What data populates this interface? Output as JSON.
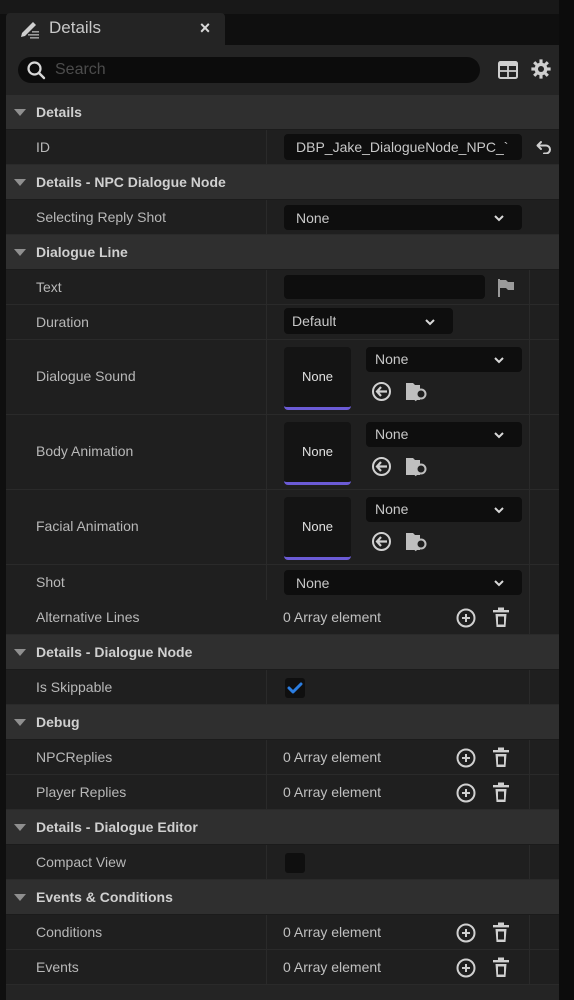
{
  "tab": {
    "title": "Details",
    "icon": "pencil-lines-icon",
    "close_label": "×"
  },
  "search": {
    "placeholder": "Search",
    "value": ""
  },
  "toolbar": {
    "table_icon": "table-view-icon",
    "settings_icon": "gear-icon"
  },
  "colors": {
    "accent_purple": "#6b5bd6",
    "check_blue": "#2b7de0",
    "panel_bg": "#242424",
    "category_bg": "#2f2f2f",
    "row_bg": "#1f1f1f",
    "field_bg": "#0e0e0e"
  },
  "sections": {
    "details": {
      "label": "Details",
      "id": {
        "label": "ID",
        "value": "DBP_Jake_DialogueNode_NPC_`"
      }
    },
    "npc_node": {
      "label": "Details - NPC Dialogue Node",
      "selecting_reply_shot": {
        "label": "Selecting Reply Shot",
        "value": "None"
      }
    },
    "dialogue_line": {
      "label": "Dialogue Line",
      "text": {
        "label": "Text",
        "value": ""
      },
      "duration": {
        "label": "Duration",
        "value": "Default"
      },
      "dialogue_sound": {
        "label": "Dialogue Sound",
        "thumb": "None",
        "value": "None"
      },
      "body_animation": {
        "label": "Body Animation",
        "thumb": "None",
        "value": "None"
      },
      "facial_animation": {
        "label": "Facial Animation",
        "thumb": "None",
        "value": "None"
      },
      "shot": {
        "label": "Shot",
        "value": "None"
      },
      "alternative_lines": {
        "label": "Alternative Lines",
        "value": "0 Array element"
      }
    },
    "dialogue_node": {
      "label": "Details - Dialogue Node",
      "is_skippable": {
        "label": "Is Skippable",
        "checked": true
      }
    },
    "debug": {
      "label": "Debug",
      "npc_replies": {
        "label": "NPCReplies",
        "value": "0 Array element"
      },
      "player_replies": {
        "label": "Player Replies",
        "value": "0 Array element"
      }
    },
    "dialogue_editor": {
      "label": "Details - Dialogue Editor",
      "compact_view": {
        "label": "Compact View",
        "checked": false
      }
    },
    "events_conditions": {
      "label": "Events & Conditions",
      "conditions": {
        "label": "Conditions",
        "value": "0 Array element"
      },
      "events": {
        "label": "Events",
        "value": "0 Array element"
      }
    }
  }
}
